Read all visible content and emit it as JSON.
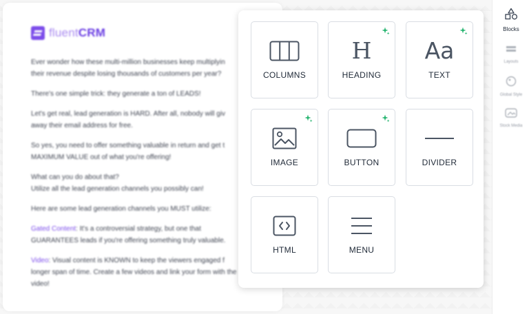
{
  "email_preview": {
    "logo": {
      "word_light": "fluent",
      "word_bold": "CRM"
    },
    "lines": [
      "Ever wonder how these multi-million businesses keep multiplyin",
      "their revenue despite losing thousands of customers per year?",
      "There's one simple trick: they generate a ton of LEADS!",
      "Let's get real, lead generation is HARD. After all, nobody will giv",
      "away their email address for free.",
      "So yes, you need to offer something valuable in return and get t",
      "MAXIMUM VALUE out of what you're offering!",
      "What can you do about that?",
      "Utilize all the lead generation channels you possibly can!",
      "Here are some lead generation channels you MUST utilize:"
    ],
    "gated": {
      "label": "Gated Content",
      "line1": ": It's a controversial strategy, but one that",
      "line2": "GUARANTEES leads if you're offering something truly valuable."
    },
    "video": {
      "label": "Video",
      "line1": ": Visual content is KNOWN to keep the viewers engaged f",
      "line2": "longer span of time. Create a few videos and link your form with the",
      "line3": "video!"
    }
  },
  "sidebar": {
    "blocks_label": "Blocks",
    "layouts_label": "Layouts",
    "global_style_label": "Global Style",
    "stock_media_label": "Stock Media"
  },
  "blocks_panel": {
    "tiles": [
      {
        "label": "COLUMNS",
        "icon": "columns-icon",
        "ai": false
      },
      {
        "label": "HEADING",
        "icon": "heading-icon",
        "ai": true
      },
      {
        "label": "TEXT",
        "icon": "text-icon",
        "ai": true
      },
      {
        "label": "IMAGE",
        "icon": "image-icon",
        "ai": true
      },
      {
        "label": "BUTTON",
        "icon": "button-icon",
        "ai": true
      },
      {
        "label": "DIVIDER",
        "icon": "divider-icon",
        "ai": false
      },
      {
        "label": "HTML",
        "icon": "html-icon",
        "ai": false
      },
      {
        "label": "MENU",
        "icon": "menu-icon",
        "ai": false
      }
    ],
    "glyphs": {
      "heading": "H",
      "text": "Aa"
    }
  },
  "colors": {
    "brand_purple": "#7c4dea",
    "ai_sparkle_green": "#2bb673",
    "icon_gray": "#4b5563",
    "tile_border": "#d9dde3"
  }
}
